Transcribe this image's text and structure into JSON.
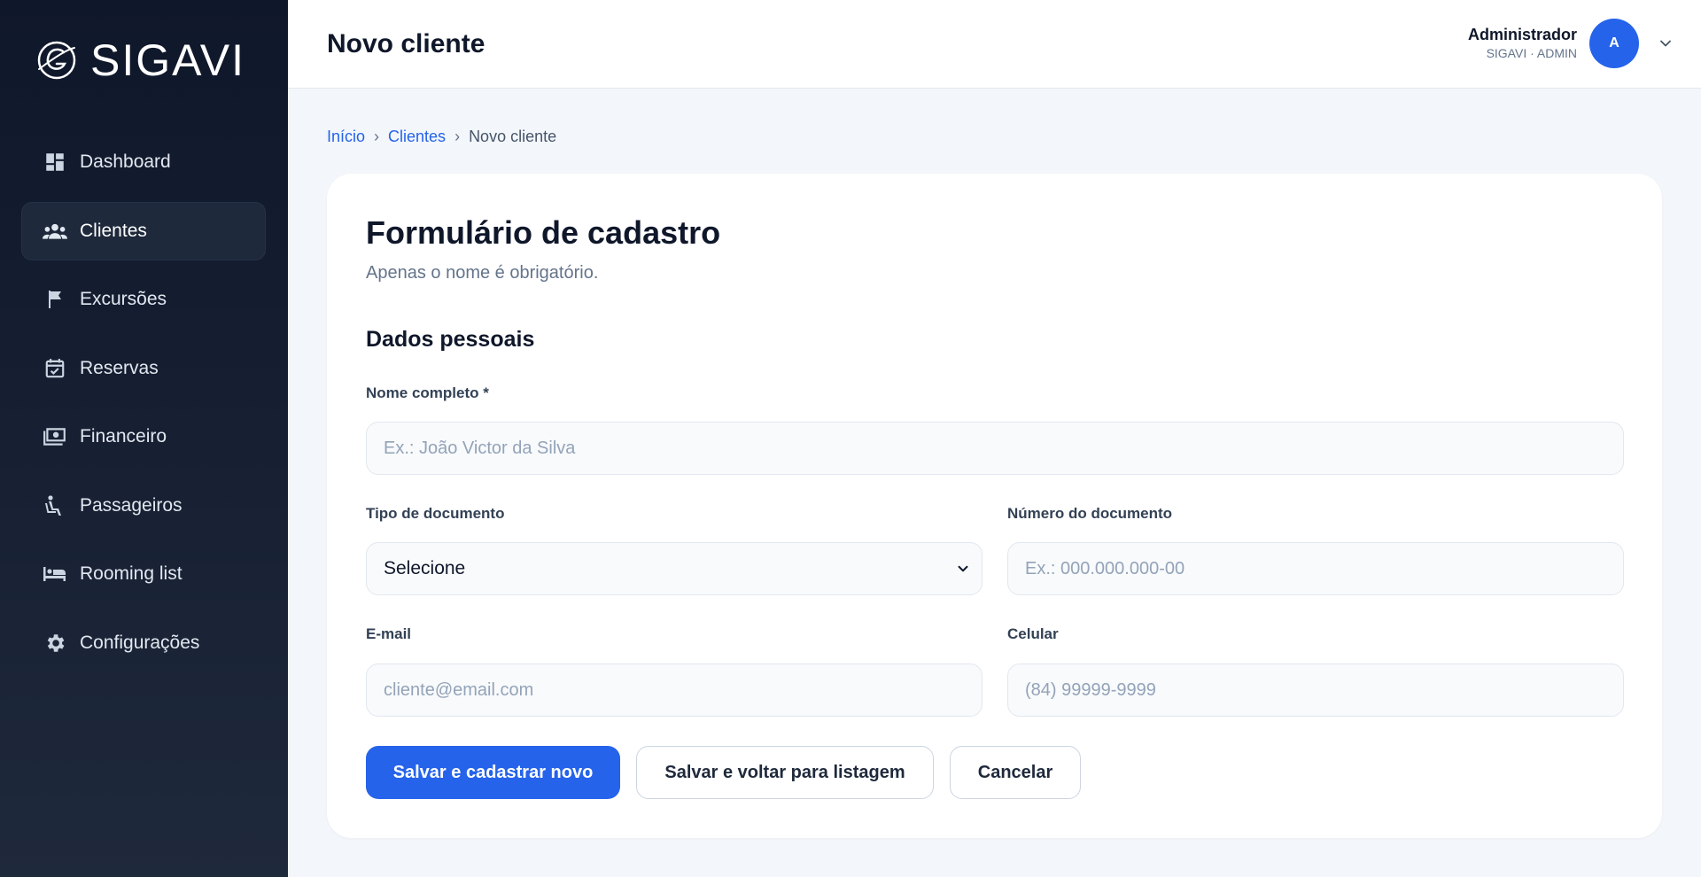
{
  "app": {
    "name": "SIGAVI"
  },
  "sidebar": {
    "items": [
      {
        "label": "Dashboard",
        "icon": "dashboard-icon"
      },
      {
        "label": "Clientes",
        "icon": "users-icon",
        "active": true
      },
      {
        "label": "Excursões",
        "icon": "flag-icon"
      },
      {
        "label": "Reservas",
        "icon": "calendar-check-icon"
      },
      {
        "label": "Financeiro",
        "icon": "money-icon"
      },
      {
        "label": "Passageiros",
        "icon": "seat-icon"
      },
      {
        "label": "Rooming list",
        "icon": "bed-icon"
      },
      {
        "label": "Configurações",
        "icon": "gear-icon"
      }
    ]
  },
  "header": {
    "title": "Novo cliente",
    "user_name": "Administrador",
    "user_role": "SIGAVI · ADMIN",
    "avatar_initial": "A"
  },
  "breadcrumb": {
    "home": "Início",
    "section": "Clientes",
    "current": "Novo cliente",
    "separator": "›"
  },
  "form": {
    "title": "Formulário de cadastro",
    "subtitle": "Apenas o nome é obrigatório.",
    "section_title": "Dados pessoais",
    "name": {
      "label": "Nome completo *",
      "value": "",
      "placeholder": "Ex.: João Victor da Silva"
    },
    "doc_type": {
      "label": "Tipo de documento",
      "selected": "Selecione"
    },
    "doc_number": {
      "label": "Número do documento",
      "value": "",
      "placeholder": "Ex.: 000.000.000-00"
    },
    "email": {
      "label": "E-mail",
      "value": "",
      "placeholder": "cliente@email.com"
    },
    "phone": {
      "label": "Celular",
      "value": "",
      "placeholder": "(84) 99999-9999"
    },
    "buttons": {
      "save_new": "Salvar e cadastrar novo",
      "save_back": "Salvar e voltar para listagem",
      "cancel": "Cancelar"
    }
  },
  "colors": {
    "sidebar_bg": "#0f172a",
    "accent": "#2563eb",
    "page_bg": "#f3f6fa"
  }
}
